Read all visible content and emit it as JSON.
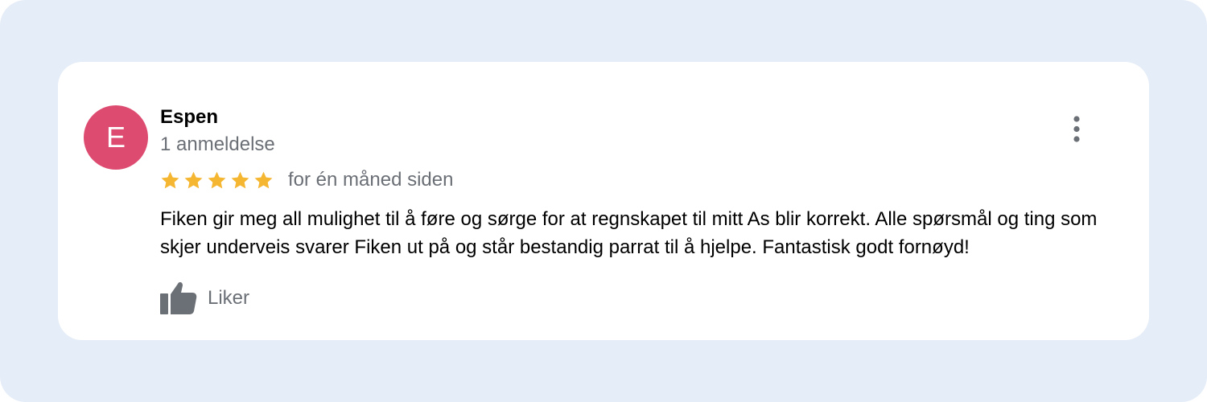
{
  "colors": {
    "background": "#e5edf8",
    "card": "#ffffff",
    "avatar": "#dd4b70",
    "star": "#f5b631",
    "muted_text": "#6b6f76",
    "icon": "#6b6f76"
  },
  "review": {
    "avatar_initial": "E",
    "author_name": "Espen",
    "review_count": "1 anmeldelse",
    "rating": 5,
    "rating_max": 5,
    "time_ago": "for én måned siden",
    "text": "Fiken gir meg all mulighet til å føre og sørge for at regnskapet til mitt As blir korrekt. Alle spørsmål og ting som skjer underveis svarer Fiken ut på og står bestandig parrat til å hjelpe. Fantastisk godt fornøyd!",
    "like_label": "Liker"
  },
  "icons": {
    "star": "star-icon",
    "like": "thumbs-up-icon",
    "more": "more-vertical-icon"
  }
}
